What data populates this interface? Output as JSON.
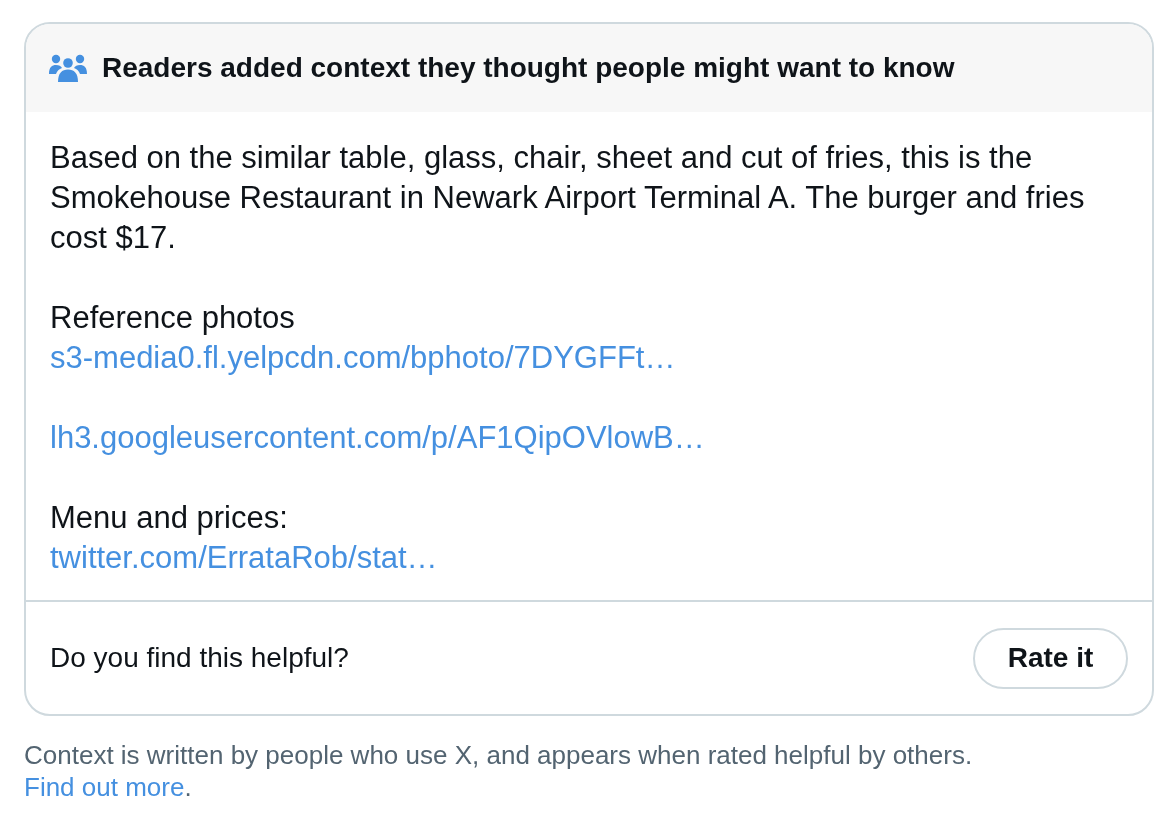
{
  "note": {
    "header": {
      "title": "Readers added context they thought people might want to know"
    },
    "groups": [
      {
        "lines": [
          {
            "kind": "text",
            "text": "Based on the similar table, glass, chair, sheet and cut of fries, this is the Smokehouse Restaurant in Newark Airport Terminal A. The burger and fries cost $17."
          }
        ]
      },
      {
        "lines": [
          {
            "kind": "text",
            "text": "Reference photos"
          },
          {
            "kind": "link",
            "text": "s3-media0.fl.yelpcdn.com/bphoto/7DYGFFt…"
          }
        ]
      },
      {
        "lines": [
          {
            "kind": "link",
            "text": "lh3.googleusercontent.com/p/AF1QipOVlowB…"
          }
        ]
      },
      {
        "lines": [
          {
            "kind": "text",
            "text": "Menu and prices:"
          },
          {
            "kind": "link",
            "text": "twitter.com/ErrataRob/stat…"
          }
        ]
      }
    ],
    "rating": {
      "question": "Do you find this helpful?",
      "button": "Rate it"
    }
  },
  "disclaimer": {
    "text": "Context is written by people who use X, and appears when rated helpful by others.",
    "link": "Find out more",
    "end": "."
  }
}
